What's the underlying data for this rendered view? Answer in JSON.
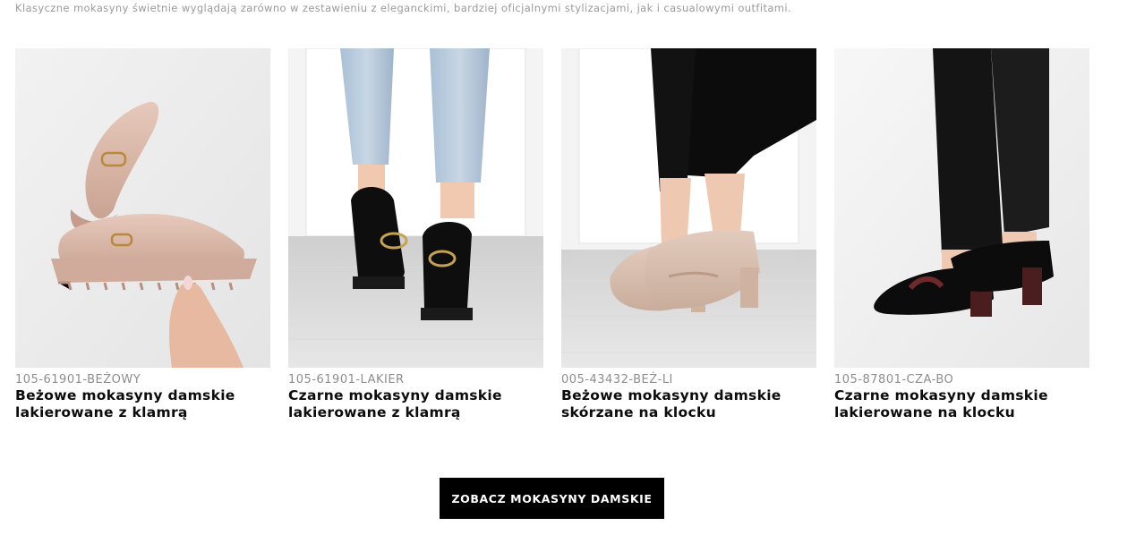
{
  "intro_text": "Klasyczne mokasyny świetnie wyglądają  zarówno w zestawieniu z eleganckimi, bardziej oficjalnymi stylizacjami, jak i casualowymi outfitami.",
  "products": [
    {
      "sku": "105-61901-BEŻOWY",
      "name": "Beżowe mokasyny damskie lakierowane z klamrą"
    },
    {
      "sku": "105-61901-LAKIER",
      "name": "Czarne mokasyny damskie lakierowane z klamrą"
    },
    {
      "sku": "005-43432-BEŻ-LI",
      "name": "Beżowe mokasyny damskie skórzane na klocku"
    },
    {
      "sku": "105-87801-CZA-BO",
      "name": "Czarne mokasyny damskie lakierowane na klocku"
    }
  ],
  "cta_label": "ZOBACZ MOKASYNY DAMSKIE",
  "colors": {
    "cta_bg": "#000000",
    "sku": "#8d8d8d",
    "intro": "#9a9a9a",
    "beige_shoe": "#d9b8a8",
    "black_shoe": "#0e0e0e"
  }
}
